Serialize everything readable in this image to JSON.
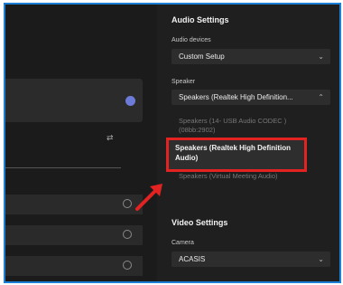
{
  "audio_settings": {
    "title": "Audio Settings",
    "devices_label": "Audio devices",
    "devices_value": "Custom Setup",
    "speaker_label": "Speaker",
    "speaker_value": "Speakers (Realtek High Definition...",
    "speaker_options": [
      "Speakers (14- USB Audio CODEC ) (08bb:2902)",
      "Speakers (Realtek High Definition Audio)",
      "Speakers (Virtual Meeting Audio)"
    ]
  },
  "video_settings": {
    "title": "Video Settings",
    "camera_label": "Camera",
    "camera_value": "ACASIS"
  },
  "icons": {
    "chevron": "chevron-down-icon",
    "sliders": "sliders-icon",
    "arrow": "red-arrow-icon"
  },
  "colors": {
    "highlight": "#e32222",
    "frame": "#1b7fd6",
    "selected_dot": "#6d7bd8"
  }
}
